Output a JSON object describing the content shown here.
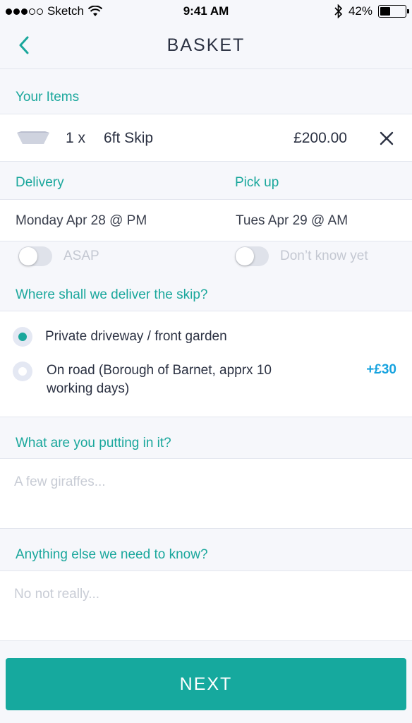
{
  "status_bar": {
    "carrier": "Sketch",
    "time": "9:41 AM",
    "battery": "42%",
    "battery_level": 0.42
  },
  "nav": {
    "title": "BASKET",
    "back_icon": "chevron-left-icon"
  },
  "items": {
    "section_label": "Your Items",
    "list": [
      {
        "qty": "1 x",
        "name": "6ft Skip",
        "price": "£200.00",
        "icon": "skip-icon",
        "remove_icon": "close-icon"
      }
    ]
  },
  "schedule": {
    "delivery_label": "Delivery",
    "pickup_label": "Pick up",
    "delivery_date": "Monday Apr 28 @ PM",
    "pickup_date": "Tues Apr 29 @ AM",
    "asap_label": "ASAP",
    "asap_on": false,
    "dont_know_label": "Don’t know yet",
    "dont_know_on": false
  },
  "address": {
    "question": "Where shall we deliver the skip?",
    "options": [
      {
        "label": "Private driveway / front garden",
        "selected": true,
        "extra": ""
      },
      {
        "label_line1": "On road (Borough of Barnet, apprx 10",
        "label_line2": "working days)",
        "selected": false,
        "extra": "+£30"
      }
    ]
  },
  "contents": {
    "question": "What are you putting in it?",
    "placeholder": "A few giraffes..."
  },
  "notes": {
    "question": "Anything else we need to know?",
    "placeholder": "No not really..."
  },
  "footer": {
    "next_label": "NEXT"
  },
  "colors": {
    "accent": "#1aa79c",
    "button": "#16a99e",
    "price_blue": "#17a3df",
    "background": "#f6f7fb"
  }
}
